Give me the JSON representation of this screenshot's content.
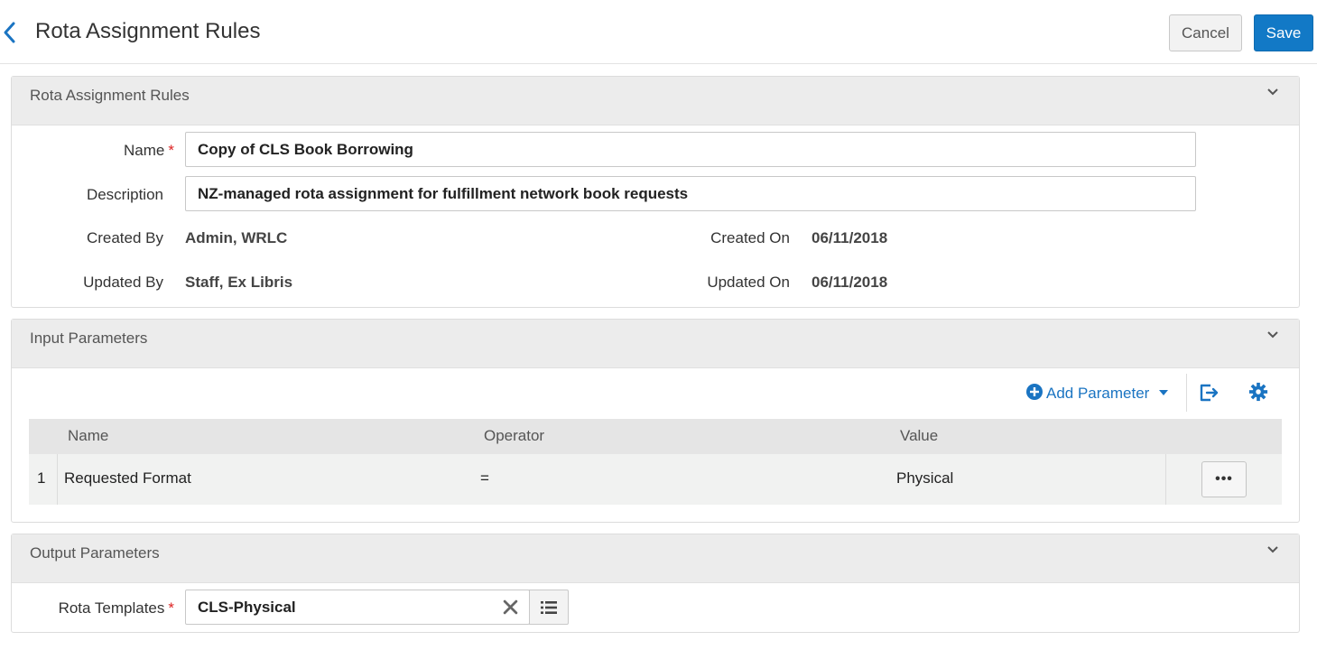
{
  "header": {
    "title": "Rota Assignment Rules",
    "cancel_label": "Cancel",
    "save_label": "Save"
  },
  "rules_panel": {
    "title": "Rota Assignment Rules",
    "name_label": "Name",
    "name_value": "Copy of CLS Book Borrowing",
    "description_label": "Description",
    "description_value": "NZ-managed rota assignment for fulfillment network book requests",
    "created_by_label": "Created By",
    "created_by_value": "Admin, WRLC",
    "created_on_label": "Created On",
    "created_on_value": "06/11/2018",
    "updated_by_label": "Updated By",
    "updated_by_value": "Staff, Ex Libris",
    "updated_on_label": "Updated On",
    "updated_on_value": "06/11/2018"
  },
  "input_panel": {
    "title": "Input Parameters",
    "add_parameter_label": "Add Parameter",
    "columns": {
      "name": "Name",
      "operator": "Operator",
      "value": "Value"
    },
    "rows": [
      {
        "index": "1",
        "name": "Requested Format",
        "operator": "=",
        "value": "Physical",
        "menu": "•••"
      }
    ]
  },
  "output_panel": {
    "title": "Output Parameters",
    "rota_templates_label": "Rota Templates",
    "rota_templates_value": "CLS-Physical"
  },
  "required_marker": "*",
  "icons": [
    "chevron-left-icon",
    "chevron-down-icon",
    "plus-circle-icon",
    "caret-down-icon",
    "export-icon",
    "gear-icon",
    "clear-x-icon",
    "list-icon"
  ],
  "colors": {
    "primary": "#1279c6",
    "required": "#dd2222",
    "link": "#1a74c2"
  }
}
